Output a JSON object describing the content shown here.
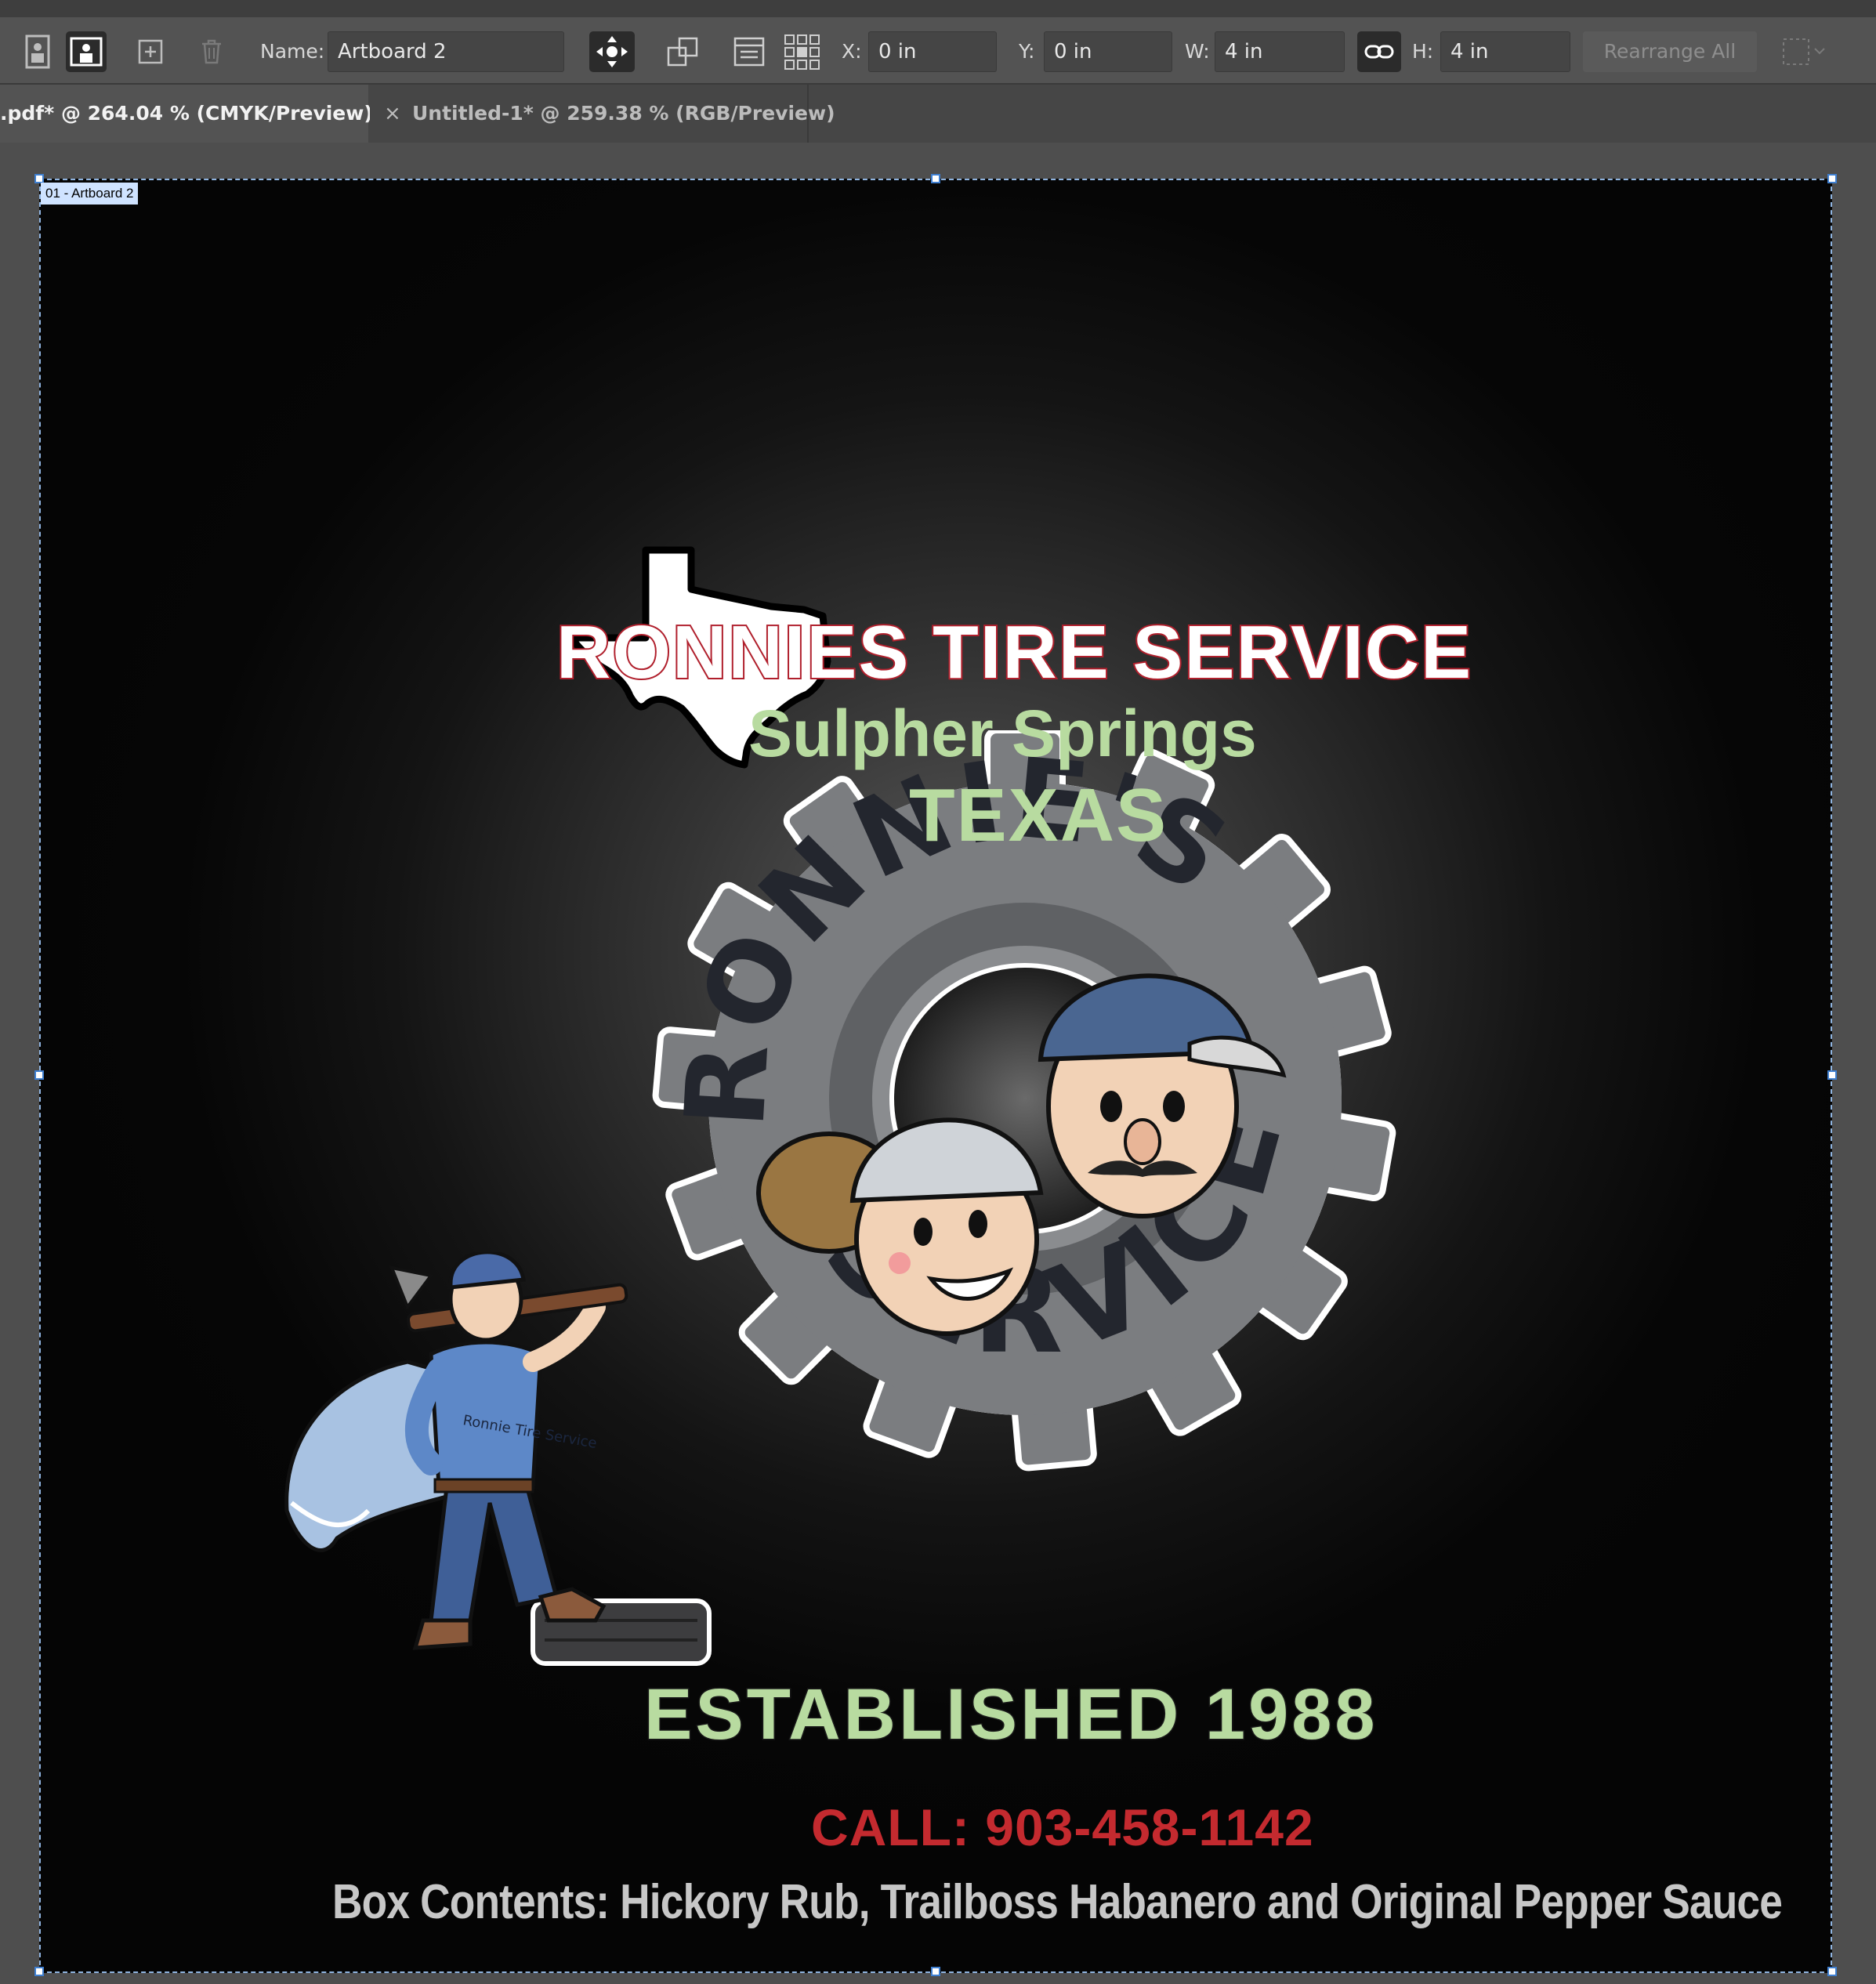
{
  "control_bar": {
    "name_label": "Name:",
    "name_value": "Artboard 2",
    "x_label": "X:",
    "x_value": "0 in",
    "y_label": "Y:",
    "y_value": "0 in",
    "w_label": "W:",
    "w_value": "4 in",
    "h_label": "H:",
    "h_value": "4 in",
    "rearrange_label": "Rearrange All"
  },
  "tabs": [
    {
      "label": ".pdf* @ 264.04 % (CMYK/Preview)",
      "active": true
    },
    {
      "label": "Untitled-1* @ 259.38 % (RGB/Preview)",
      "active": false,
      "close": "×"
    }
  ],
  "artboard": {
    "label": "01 - Artboard 2"
  },
  "artwork": {
    "title": "RONNIES TIRE SERVICE",
    "city": "Sulpher Springs",
    "state": "TEXAS",
    "logo_text_top": "RONNIE'S TIRE",
    "logo_text_bottom": "SERVICE",
    "mascot_shirt_text": "Ronnie Tire Service",
    "established": "ESTABLISHED 1988",
    "call": "CALL: 903-458-1142",
    "contents": "Box Contents: Hickory Rub, Trailboss Habanero and Original Pepper Sauce"
  },
  "colors": {
    "title_fill": "#ffffff",
    "title_stroke": "#b01f2c",
    "green_text": "#b8dba0",
    "call_red": "#c42a2f",
    "gear_gray": "#7b7d80",
    "ui_bg": "#535353"
  }
}
